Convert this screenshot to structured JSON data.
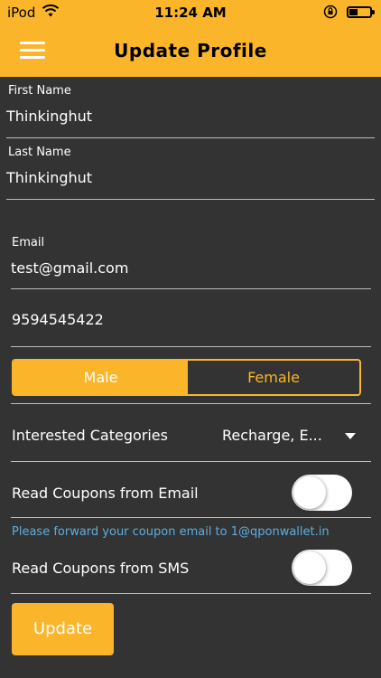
{
  "status_bar": {
    "carrier": "iPod",
    "time": "11:24 AM",
    "icons": [
      "wifi-icon",
      "rotation-lock-icon",
      "battery-icon"
    ],
    "battery_level": 0.3
  },
  "header": {
    "title": "Update Profile",
    "menu_icon": "hamburger-menu-icon"
  },
  "form": {
    "first_name": {
      "label": "First Name",
      "value": "Thinkinghut"
    },
    "last_name": {
      "label": "Last Name",
      "value": "Thinkinghut"
    },
    "email": {
      "label": "Email",
      "value": "test@gmail.com"
    },
    "phone": {
      "value": "9594545422"
    },
    "gender": {
      "options": [
        "Male",
        "Female"
      ],
      "selected": "Male"
    },
    "categories": {
      "label": "Interested Categories",
      "value": "Recharge, E...",
      "icon": "dropdown-caret-icon"
    },
    "email_coupons": {
      "label": "Read Coupons from Email",
      "enabled": false
    },
    "hint": "Please forward your coupon email to 1@qponwallet.in",
    "sms_coupons": {
      "label": "Read Coupons from SMS",
      "enabled": false
    },
    "submit_label": "Update"
  },
  "colors": {
    "accent": "#FBB52B",
    "background": "#333333",
    "hint": "#5dade2"
  }
}
